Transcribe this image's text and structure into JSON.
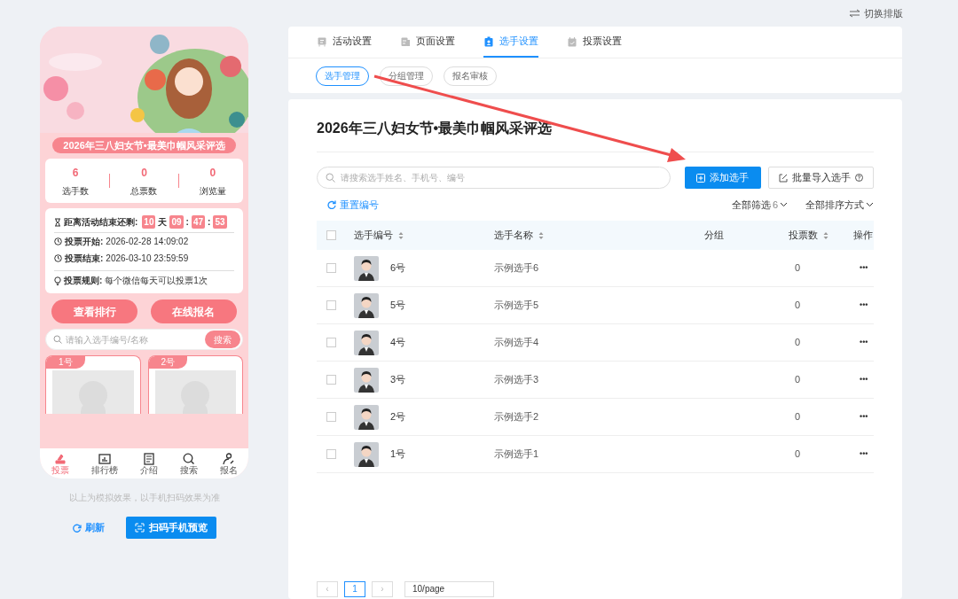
{
  "layout_switch": "切换排版",
  "preview": {
    "banner": {
      "kind": "picture"
    },
    "title": "2026年三八妇女节•最美巾帼风采评选",
    "stats": [
      {
        "value": "6",
        "label": "选手数"
      },
      {
        "value": "0",
        "label": "总票数"
      },
      {
        "value": "0",
        "label": "浏览量"
      }
    ],
    "countdown": {
      "label": "距离活动结束还剩:",
      "parts": [
        {
          "kind": "digit",
          "text": "10"
        },
        {
          "kind": "sep",
          "text": "天"
        },
        {
          "kind": "digit",
          "text": "09"
        },
        {
          "kind": "sep",
          "text": ":"
        },
        {
          "kind": "digit",
          "text": "47"
        },
        {
          "kind": "sep",
          "text": ":"
        },
        {
          "kind": "digit",
          "text": "53"
        }
      ]
    },
    "info": [
      {
        "kind": "clock",
        "label": "投票开始:",
        "value": "2026-02-28 14:09:02"
      },
      {
        "kind": "clock",
        "label": "投票结束:",
        "value": "2026-03-10 23:59:59"
      },
      {
        "kind": "bulb",
        "label": "投票规则:",
        "value": "每个微信每天可以投票1次"
      }
    ],
    "buttons": [
      "查看排行",
      "在线报名"
    ],
    "search": {
      "placeholder": "请输入选手编号/名称",
      "button": "搜索"
    },
    "cards": [
      {
        "tag": "1号"
      },
      {
        "tag": "2号"
      }
    ],
    "nav": [
      {
        "kind": "vote",
        "label": "投票",
        "selected": true
      },
      {
        "kind": "chart",
        "label": "排行榜",
        "selected": false
      },
      {
        "kind": "doc",
        "label": "介绍",
        "selected": false
      },
      {
        "kind": "search",
        "label": "搜索",
        "selected": false
      },
      {
        "kind": "user",
        "label": "报名",
        "selected": false
      }
    ],
    "note": "以上为模拟效果，以手机扫码效果为准",
    "refresh": "刷新",
    "qr_preview": "扫码手机预览"
  },
  "tabs": [
    {
      "kind": "activity",
      "label": "活动设置",
      "selected": false
    },
    {
      "kind": "page",
      "label": "页面设置",
      "selected": false
    },
    {
      "kind": "player",
      "label": "选手设置",
      "selected": true
    },
    {
      "kind": "vote",
      "label": "投票设置",
      "selected": false
    }
  ],
  "subtabs": [
    {
      "label": "选手管理",
      "selected": true
    },
    {
      "label": "分组管理",
      "selected": false
    },
    {
      "label": "报名审核",
      "selected": false
    }
  ],
  "heading": "2026年三八妇女节•最美巾帼风采评选",
  "search": {
    "placeholder": "请搜索选手姓名、手机号、编号"
  },
  "add_button": "添加选手",
  "import_button": "批量导入选手",
  "reset": "重置编号",
  "filter": {
    "label": "全部筛选",
    "count": "6"
  },
  "sort": "全部排序方式",
  "table": {
    "select_all": {
      "checked": false
    },
    "columns": [
      {
        "label": "选手编号",
        "sortable": true
      },
      {
        "label": "选手名称",
        "sortable": true
      },
      {
        "label": "分组",
        "sortable": false
      },
      {
        "label": "投票数",
        "sortable": true
      },
      {
        "label": "操作",
        "sortable": false
      }
    ],
    "rows": [
      {
        "checked": false,
        "number": "6号",
        "name": "示例选手6",
        "votes": "0",
        "action": "•••"
      },
      {
        "checked": false,
        "number": "5号",
        "name": "示例选手5",
        "votes": "0",
        "action": "•••"
      },
      {
        "checked": false,
        "number": "4号",
        "name": "示例选手4",
        "votes": "0",
        "action": "•••"
      },
      {
        "checked": false,
        "number": "3号",
        "name": "示例选手3",
        "votes": "0",
        "action": "•••"
      },
      {
        "checked": false,
        "number": "2号",
        "name": "示例选手2",
        "votes": "0",
        "action": "•••"
      },
      {
        "checked": false,
        "number": "1号",
        "name": "示例选手1",
        "votes": "0",
        "action": "•••"
      }
    ]
  },
  "pagination": {
    "prev": "‹",
    "pages": [
      {
        "label": "1",
        "selected": true
      }
    ],
    "next": "›",
    "page_size": "10/page"
  }
}
